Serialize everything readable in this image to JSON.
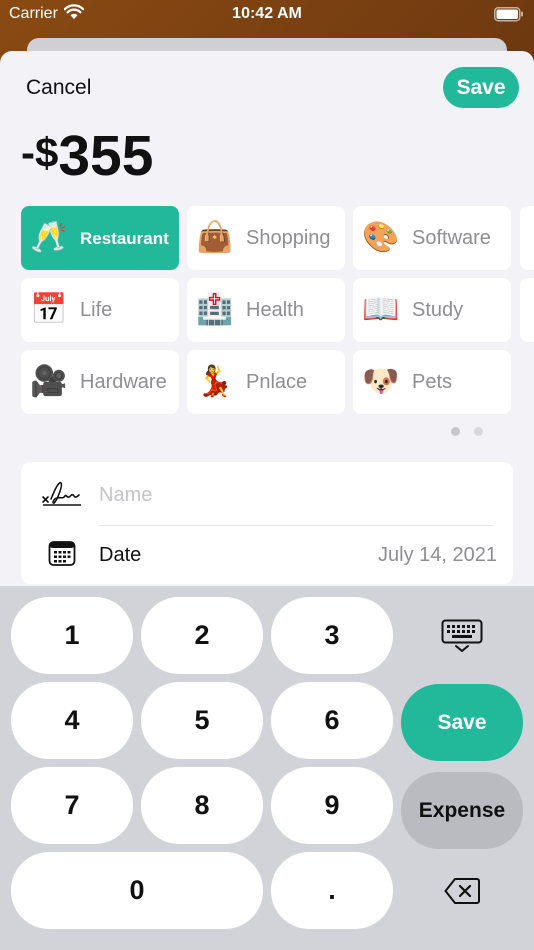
{
  "status_bar": {
    "carrier": "Carrier",
    "time": "10:42 AM"
  },
  "header": {
    "cancel_label": "Cancel",
    "save_label": "Save"
  },
  "amount": {
    "sign": "-$",
    "value": "355"
  },
  "categories": [
    {
      "label": "Restaurant",
      "emoji": "🥂",
      "selected": true
    },
    {
      "label": "Shopping",
      "emoji": "👜",
      "selected": false
    },
    {
      "label": "Software",
      "emoji": "🎨",
      "selected": false
    },
    {
      "label": "Life",
      "emoji": "📅",
      "selected": false
    },
    {
      "label": "Health",
      "emoji": "🏥",
      "selected": false
    },
    {
      "label": "Study",
      "emoji": "📖",
      "selected": false
    },
    {
      "label": "Hardware",
      "emoji": "🎥",
      "selected": false
    },
    {
      "label": "Pnlace",
      "emoji": "💃",
      "selected": false
    },
    {
      "label": "Pets",
      "emoji": "🐶",
      "selected": false
    }
  ],
  "pager": {
    "pages": 2,
    "current": 1
  },
  "form": {
    "name_placeholder": "Name",
    "name_value": "",
    "date_label": "Date",
    "date_value": "July 14, 2021"
  },
  "keypad": {
    "k1": "1",
    "k2": "2",
    "k3": "3",
    "k4": "4",
    "k5": "5",
    "k6": "6",
    "k7": "7",
    "k8": "8",
    "k9": "9",
    "k0": "0",
    "dot": ".",
    "save_label": "Save",
    "type_label": "Expense"
  },
  "colors": {
    "accent": "#22b99a",
    "sheet_background": "#f2f2f7",
    "keypad_background": "#d1d3d9"
  },
  "icons": {
    "wifi": "wifi-icon",
    "battery": "battery-icon",
    "signature": "signature-icon",
    "calendar": "calendar-icon",
    "keyboard": "keyboard-dismiss-icon",
    "delete": "backspace-icon"
  }
}
